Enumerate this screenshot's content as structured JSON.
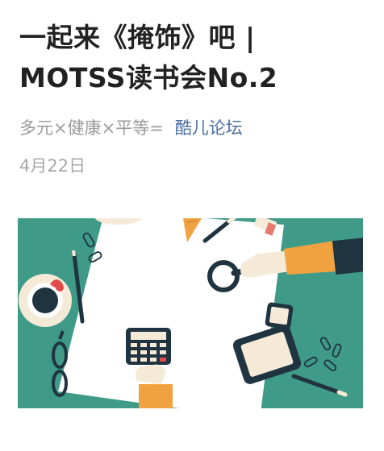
{
  "article": {
    "title_line1": "一起来《掩饰》吧 |",
    "title_line2": "MOTSS读书会No.2",
    "author": "多元×健康×平等=",
    "account": "酷儿论坛",
    "date": "4月22日"
  },
  "cover_image": {
    "colors": {
      "background": "#3f9b88",
      "paper": "#ffffff",
      "sleeve": "#f0a240",
      "dark": "#1f3440",
      "cream": "#f4ead7"
    }
  }
}
